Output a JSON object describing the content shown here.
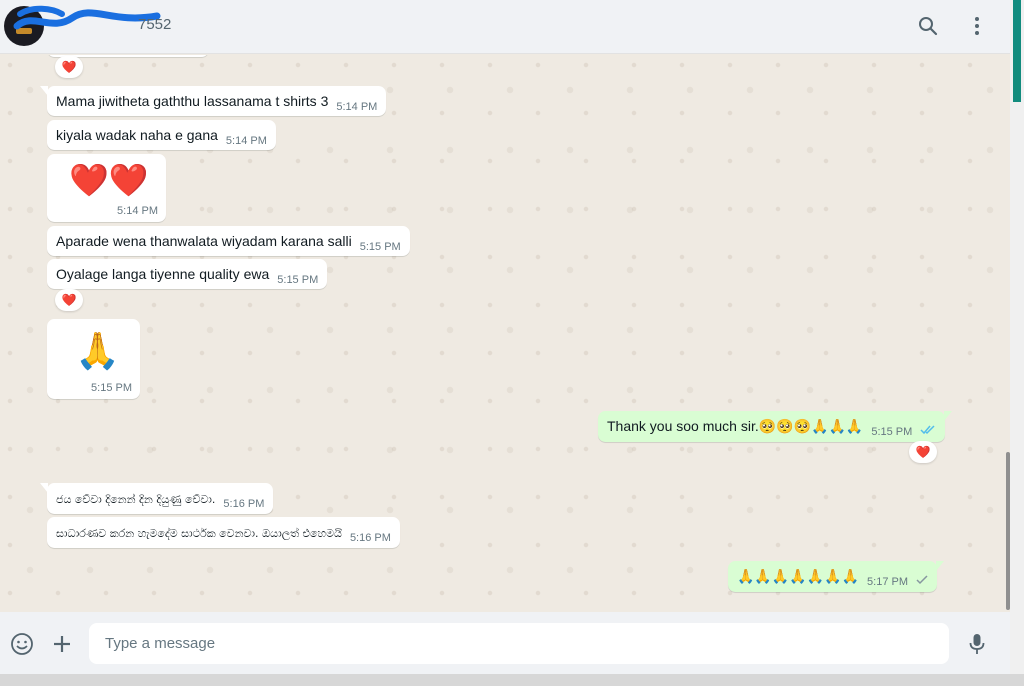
{
  "header": {
    "contact_name_visible": "7552",
    "search_icon": "search-icon",
    "menu_icon": "kebab-menu-icon"
  },
  "messages": [
    {
      "id": "m1",
      "dir": "in",
      "text": "Mama jiwitheta gaththu lassanama t shirts 3",
      "time": "5:14 PM"
    },
    {
      "id": "m2",
      "dir": "in",
      "text": "kiyala wadak naha e gana",
      "time": "5:14 PM"
    },
    {
      "id": "m3",
      "dir": "in",
      "text": "❤️❤️",
      "time": "5:14 PM",
      "emoji_only": true
    },
    {
      "id": "m4",
      "dir": "in",
      "text": "Aparade wena thanwalata wiyadam karana salli",
      "time": "5:15 PM"
    },
    {
      "id": "m5",
      "dir": "in",
      "text": "Oyalage langa tiyenne quality ewa",
      "time": "5:15 PM",
      "reaction": "❤️"
    },
    {
      "id": "m6",
      "dir": "in",
      "text": "🙏",
      "time": "5:15 PM",
      "emoji_only": true
    },
    {
      "id": "m7",
      "dir": "out",
      "text": "Thank you soo much sir.🥺🥺🥺🙏🙏🙏",
      "time": "5:15 PM",
      "status": "read",
      "reaction": "❤️"
    },
    {
      "id": "m8",
      "dir": "in",
      "text": "ජය වේවා දිනෙන් දින දියුණු වේවා.",
      "time": "5:16 PM"
    },
    {
      "id": "m9",
      "dir": "in",
      "text": "සාධාරණව කරන හැමදේම සාර්ථක වෙනවා. ඔයාලත් එහෙමයි",
      "time": "5:16 PM"
    },
    {
      "id": "m10",
      "dir": "out",
      "text": "🙏🙏🙏🙏🙏🙏🙏",
      "time": "5:17 PM",
      "status": "sent"
    }
  ],
  "top_reaction": "❤️",
  "composer": {
    "placeholder": "Type a message",
    "value": ""
  },
  "colors": {
    "incoming_bubble": "#ffffff",
    "outgoing_bubble": "#d9fdd3",
    "chat_background": "#efeae2",
    "read_ticks": "#53bdeb",
    "accent": "#128c7e",
    "reaction_heart": "#e0245e"
  }
}
